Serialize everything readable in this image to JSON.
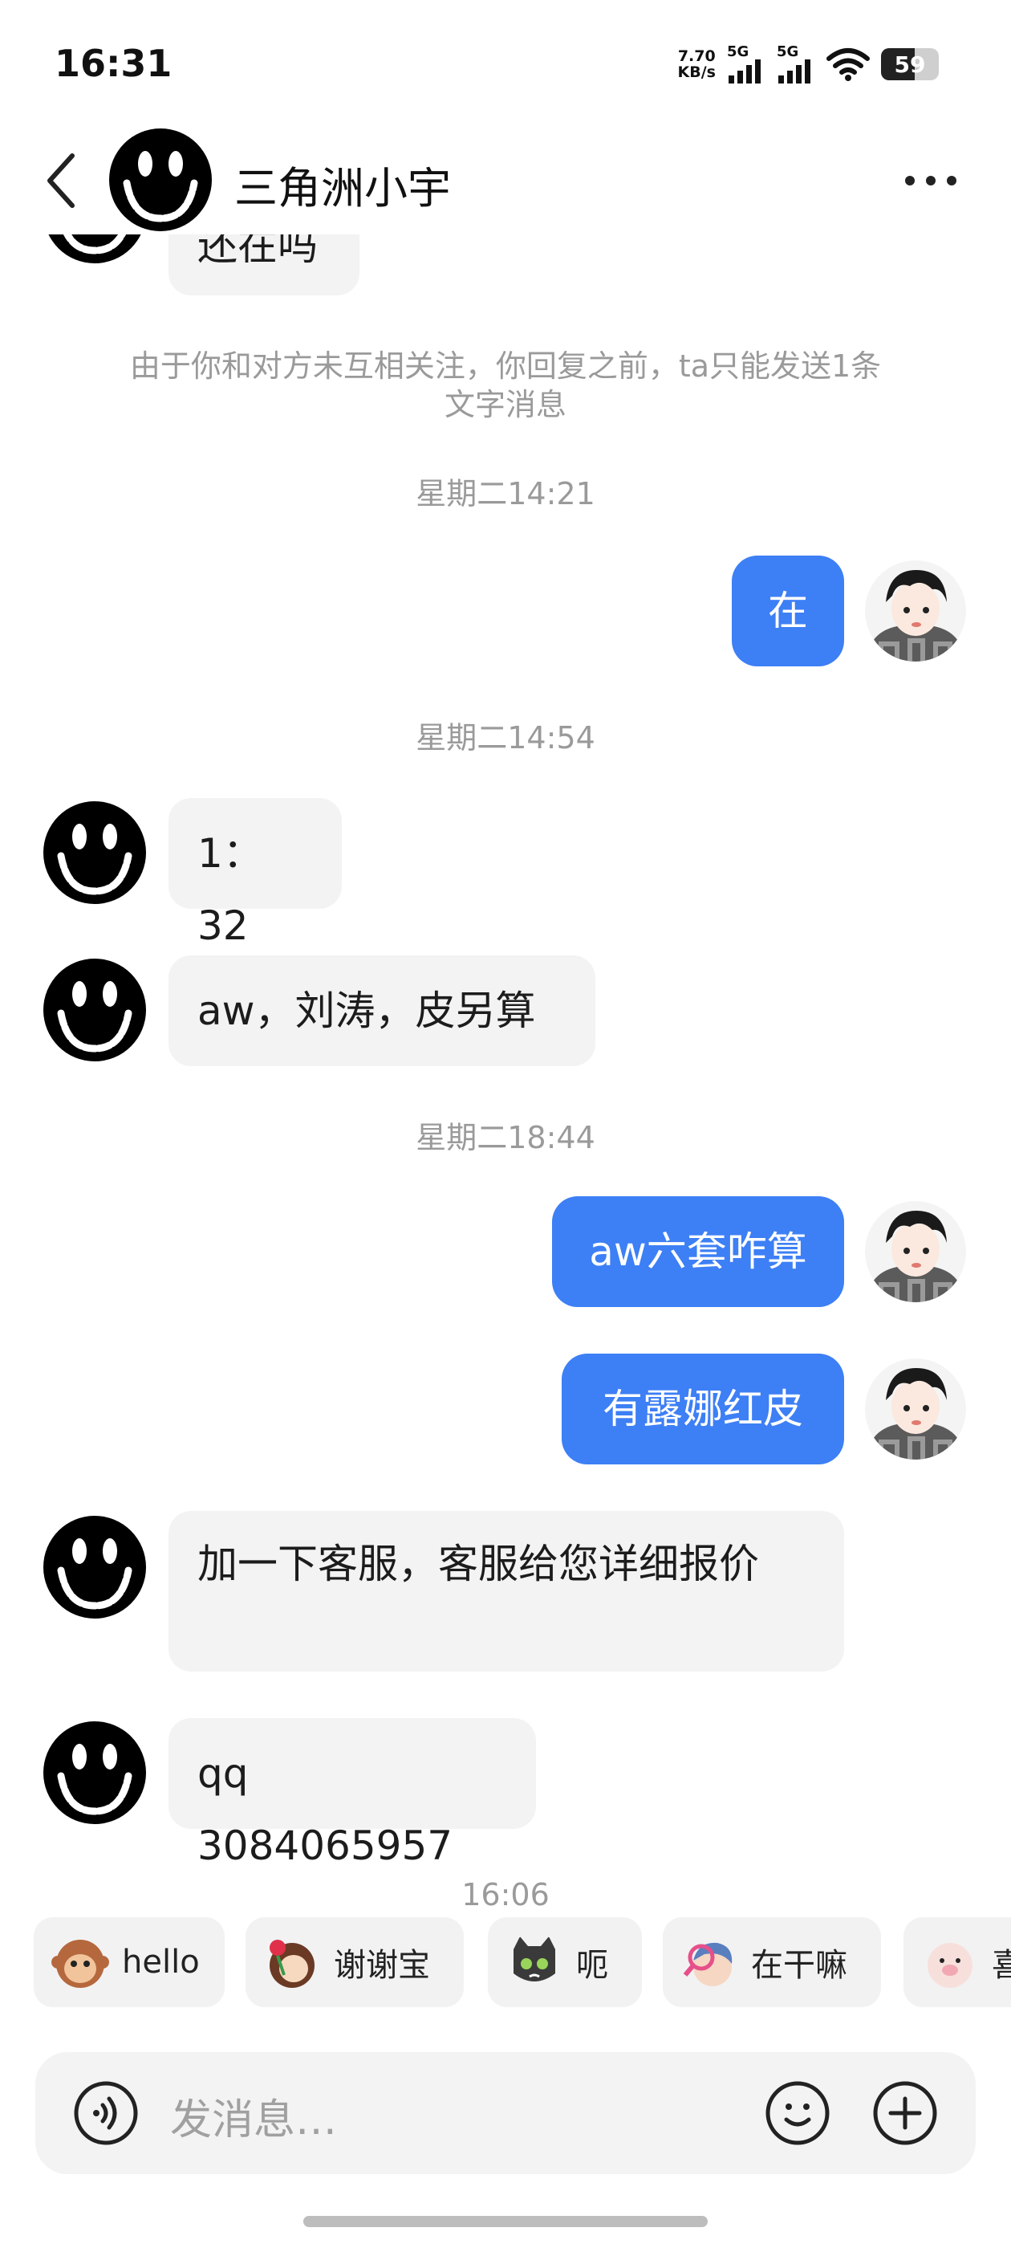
{
  "status_bar": {
    "time": "16:31",
    "net_speed_value": "7.70",
    "net_speed_unit": "KB/s",
    "signal1_label": "5G",
    "signal2_label": "5G",
    "battery": "59",
    "battery_level": 0.59
  },
  "header": {
    "title": "三角洲小宇",
    "back_icon": "chevron-left-icon",
    "more_icon": "more-dots-icon"
  },
  "messages": {
    "m0": {
      "text": "还在吗",
      "from": "other"
    },
    "notice": "由于你和对方未互相关注，你回复之前，ta只能发送1条文字消息",
    "ts1": "星期二14:21",
    "m1": {
      "text": "在",
      "from": "me"
    },
    "ts2": "星期二14:54",
    "m2": {
      "text": "1：32",
      "from": "other"
    },
    "m3": {
      "text": "aw，刘涛，皮另算",
      "from": "other"
    },
    "ts3": "星期二18:44",
    "m4": {
      "text": "aw六套咋算",
      "from": "me"
    },
    "m5": {
      "text": "有露娜红皮",
      "from": "me"
    },
    "m6": {
      "text": "加一下客服，客服给您详细报价",
      "from": "other"
    },
    "m7": {
      "text": "qq 3084065957",
      "from": "other"
    },
    "ts4": "16:06"
  },
  "quick_replies": [
    {
      "label": "hello",
      "icon": "monkey-icon"
    },
    {
      "label": "谢谢宝",
      "icon": "girl-rose-icon"
    },
    {
      "label": "呃",
      "icon": "cat-icon"
    },
    {
      "label": "在干嘛",
      "icon": "magnifier-girl-icon"
    },
    {
      "label": "喜",
      "icon": "piggy-icon"
    }
  ],
  "input": {
    "placeholder": "发消息…",
    "voice_icon": "voice-icon",
    "emoji_icon": "emoji-icon",
    "plus_icon": "plus-icon"
  },
  "colors": {
    "outgoing_bubble": "#3d7ff5",
    "incoming_bubble": "#f3f3f4",
    "timestamp": "#9a9a9a"
  }
}
